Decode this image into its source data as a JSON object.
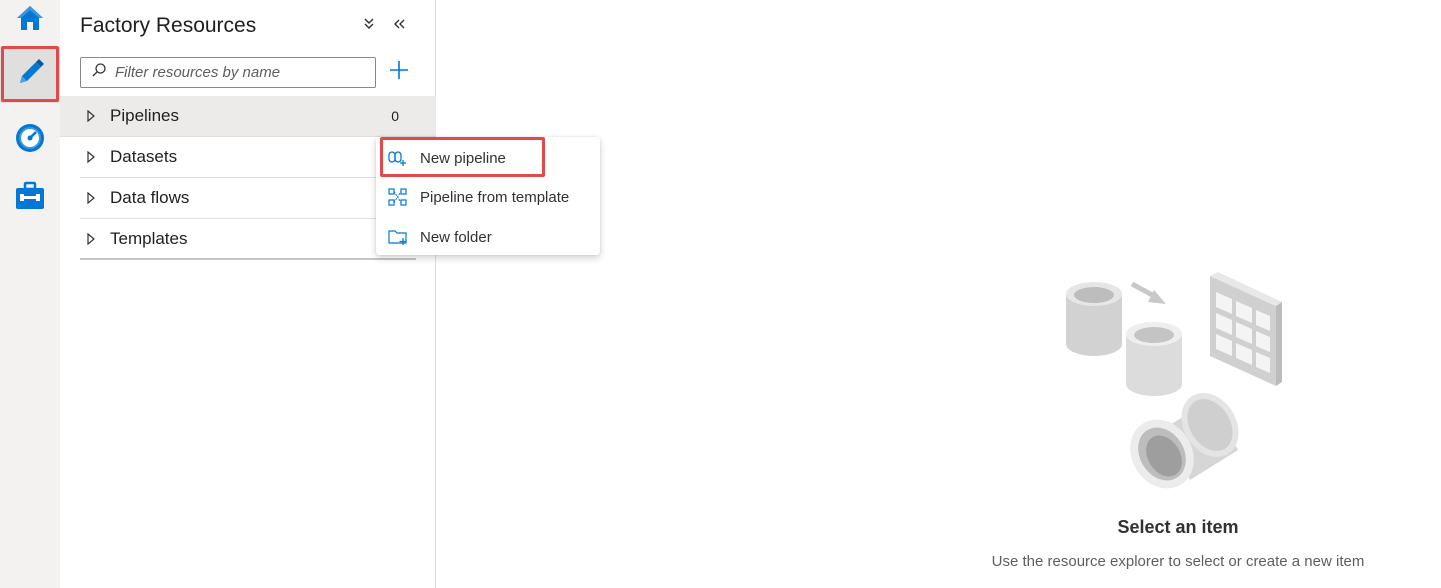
{
  "rail": {
    "items": [
      {
        "icon": "home-icon"
      },
      {
        "icon": "pencil-icon",
        "active": true
      },
      {
        "icon": "monitor-icon"
      },
      {
        "icon": "toolbox-icon"
      }
    ]
  },
  "panel": {
    "title": "Factory Resources",
    "search_placeholder": "Filter resources by name",
    "tree": [
      {
        "label": "Pipelines",
        "count": "0"
      },
      {
        "label": "Datasets"
      },
      {
        "label": "Data flows"
      },
      {
        "label": "Templates"
      }
    ]
  },
  "context_menu": {
    "items": [
      {
        "label": "New pipeline",
        "icon": "pipeline-icon"
      },
      {
        "label": "Pipeline from template",
        "icon": "template-icon"
      },
      {
        "label": "New folder",
        "icon": "new-folder-icon"
      }
    ]
  },
  "empty_state": {
    "title": "Select an item",
    "subtitle": "Use the resource explorer to select or create a new item"
  },
  "colors": {
    "accent": "#0078d4",
    "highlight": "#e04a4a"
  }
}
